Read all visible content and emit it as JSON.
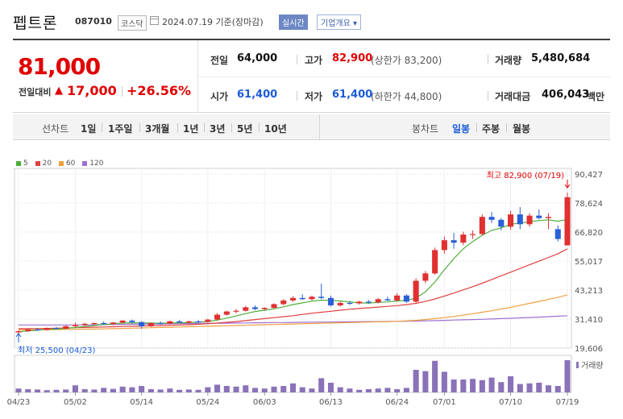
{
  "header": {
    "name": "펩트론",
    "code": "087010",
    "market": "코스닥",
    "date_text": "2024.07.19 기준(장마감)",
    "realtime": "실시간",
    "company_overview": "기업개요",
    "company_overview_arrow": "▾"
  },
  "quote": {
    "price": "81,000",
    "change_label": "전일대비",
    "change_arrow": "▲",
    "change": "17,000",
    "rate": "+26.56%",
    "prev_close_label": "전일",
    "prev_close": "64,000",
    "high_label": "고가",
    "high": "82,900",
    "upper_limit": "(상한가 83,200)",
    "volume_label": "거래량",
    "volume": "5,480,684",
    "open_label": "시가",
    "open": "61,400",
    "low_label": "저가",
    "low": "61,400",
    "lower_limit": "(하한가 44,800)",
    "amount_label": "거래대금",
    "amount": "406,043",
    "amount_unit": "백만"
  },
  "period_bar": {
    "line_label": "선차트",
    "line_items": [
      "1일",
      "1주일",
      "3개월",
      "1년",
      "3년",
      "5년",
      "10년"
    ],
    "candle_label": "봉차트",
    "candle_items": [
      "일봉",
      "주봉",
      "월봉"
    ],
    "candle_active": "일봉"
  },
  "colors": {
    "up": "#e03030",
    "down": "#2a5fd8",
    "ma5": "#4caf3a",
    "ma20": "#e04040",
    "ma60": "#f0a040",
    "ma120": "#a070d0",
    "volume": "#8a72b8"
  },
  "chart_data": {
    "type": "candlestick",
    "legend": [
      {
        "name": "5",
        "color": "#4caf3a"
      },
      {
        "name": "20",
        "color": "#e04040"
      },
      {
        "name": "60",
        "color": "#f0a040"
      },
      {
        "name": "120",
        "color": "#a070d0"
      }
    ],
    "y_ticks": [
      "90,427",
      "78,624",
      "66,820",
      "55,017",
      "43,213",
      "31,410",
      "19,606"
    ],
    "y_tick_values": [
      90427,
      78624,
      66820,
      55017,
      43213,
      31410,
      19606
    ],
    "ylim": [
      19606,
      90427
    ],
    "x_ticks": [
      "04/23",
      "05/02",
      "05/14",
      "05/24",
      "06/03",
      "06/13",
      "06/24",
      "07/01",
      "07/10",
      "07/19"
    ],
    "x_tick_index": [
      0,
      6,
      13,
      20,
      26,
      33,
      40,
      45,
      52,
      58
    ],
    "max_annotation": "최고 82,900 (07/19)",
    "min_annotation": "최저 25,500 (04/23)",
    "volume_label": "거래량",
    "candles": [
      {
        "o": 26000,
        "h": 26800,
        "l": 25500,
        "c": 26500
      },
      {
        "o": 26500,
        "h": 27500,
        "l": 26200,
        "c": 27200
      },
      {
        "o": 27200,
        "h": 27800,
        "l": 26800,
        "c": 27000
      },
      {
        "o": 27000,
        "h": 28000,
        "l": 26800,
        "c": 27800
      },
      {
        "o": 27800,
        "h": 28200,
        "l": 27200,
        "c": 27500
      },
      {
        "o": 27500,
        "h": 28800,
        "l": 27200,
        "c": 28500
      },
      {
        "o": 28500,
        "h": 30000,
        "l": 28000,
        "c": 29000
      },
      {
        "o": 29000,
        "h": 29800,
        "l": 28500,
        "c": 29500
      },
      {
        "o": 29500,
        "h": 30000,
        "l": 29000,
        "c": 29800
      },
      {
        "o": 29800,
        "h": 30500,
        "l": 29000,
        "c": 29400
      },
      {
        "o": 29400,
        "h": 30200,
        "l": 29000,
        "c": 30000
      },
      {
        "o": 30000,
        "h": 31000,
        "l": 29500,
        "c": 30800
      },
      {
        "o": 30800,
        "h": 31200,
        "l": 29800,
        "c": 30200
      },
      {
        "o": 30200,
        "h": 30500,
        "l": 27500,
        "c": 28500
      },
      {
        "o": 28500,
        "h": 30000,
        "l": 28200,
        "c": 29800
      },
      {
        "o": 29800,
        "h": 30500,
        "l": 29200,
        "c": 29500
      },
      {
        "o": 29500,
        "h": 30800,
        "l": 29300,
        "c": 30500
      },
      {
        "o": 30500,
        "h": 31000,
        "l": 29800,
        "c": 30000
      },
      {
        "o": 30000,
        "h": 30800,
        "l": 29500,
        "c": 30500
      },
      {
        "o": 30500,
        "h": 31000,
        "l": 29800,
        "c": 30300
      },
      {
        "o": 30300,
        "h": 31500,
        "l": 30000,
        "c": 31200
      },
      {
        "o": 31200,
        "h": 33800,
        "l": 30800,
        "c": 33200
      },
      {
        "o": 33200,
        "h": 34800,
        "l": 32800,
        "c": 34500
      },
      {
        "o": 34500,
        "h": 35500,
        "l": 33800,
        "c": 34800
      },
      {
        "o": 34800,
        "h": 36800,
        "l": 34500,
        "c": 36200
      },
      {
        "o": 36200,
        "h": 37000,
        "l": 35000,
        "c": 35500
      },
      {
        "o": 35500,
        "h": 36200,
        "l": 34800,
        "c": 36000
      },
      {
        "o": 36000,
        "h": 37800,
        "l": 35500,
        "c": 37500
      },
      {
        "o": 37500,
        "h": 39500,
        "l": 37000,
        "c": 39000
      },
      {
        "o": 39000,
        "h": 40800,
        "l": 38500,
        "c": 40000
      },
      {
        "o": 40000,
        "h": 41500,
        "l": 39200,
        "c": 39500
      },
      {
        "o": 39500,
        "h": 41000,
        "l": 39000,
        "c": 40500
      },
      {
        "o": 40500,
        "h": 45800,
        "l": 39500,
        "c": 40000
      },
      {
        "o": 40000,
        "h": 41000,
        "l": 36500,
        "c": 37000
      },
      {
        "o": 37000,
        "h": 38500,
        "l": 36500,
        "c": 38000
      },
      {
        "o": 38000,
        "h": 38800,
        "l": 37200,
        "c": 37800
      },
      {
        "o": 37800,
        "h": 38800,
        "l": 37300,
        "c": 38500
      },
      {
        "o": 38500,
        "h": 39200,
        "l": 37600,
        "c": 38200
      },
      {
        "o": 38200,
        "h": 40000,
        "l": 37800,
        "c": 39500
      },
      {
        "o": 39500,
        "h": 40500,
        "l": 38800,
        "c": 39000
      },
      {
        "o": 39000,
        "h": 42000,
        "l": 38500,
        "c": 41000
      },
      {
        "o": 41000,
        "h": 41500,
        "l": 38000,
        "c": 38500
      },
      {
        "o": 38500,
        "h": 48000,
        "l": 38000,
        "c": 47000
      },
      {
        "o": 47000,
        "h": 51000,
        "l": 46000,
        "c": 50000
      },
      {
        "o": 50000,
        "h": 60500,
        "l": 49500,
        "c": 59500
      },
      {
        "o": 59500,
        "h": 65000,
        "l": 58000,
        "c": 63500
      },
      {
        "o": 63500,
        "h": 66500,
        "l": 60000,
        "c": 62500
      },
      {
        "o": 62500,
        "h": 67000,
        "l": 61500,
        "c": 65800
      },
      {
        "o": 65800,
        "h": 67500,
        "l": 64000,
        "c": 66000
      },
      {
        "o": 66000,
        "h": 74000,
        "l": 65500,
        "c": 73000
      },
      {
        "o": 73000,
        "h": 75000,
        "l": 70500,
        "c": 71800
      },
      {
        "o": 71800,
        "h": 72500,
        "l": 67500,
        "c": 69000
      },
      {
        "o": 69000,
        "h": 75500,
        "l": 67800,
        "c": 74000
      },
      {
        "o": 74000,
        "h": 77000,
        "l": 68000,
        "c": 70000
      },
      {
        "o": 70000,
        "h": 74500,
        "l": 69000,
        "c": 73500
      },
      {
        "o": 73500,
        "h": 76000,
        "l": 72000,
        "c": 72500
      },
      {
        "o": 72500,
        "h": 74500,
        "l": 68000,
        "c": 73000
      },
      {
        "o": 68000,
        "h": 69500,
        "l": 63000,
        "c": 64000
      },
      {
        "o": 61400,
        "h": 82900,
        "l": 61400,
        "c": 81000
      }
    ],
    "volumes": [
      12,
      10,
      9,
      7,
      8,
      9,
      22,
      10,
      9,
      14,
      11,
      18,
      16,
      20,
      10,
      9,
      12,
      8,
      9,
      8,
      16,
      24,
      20,
      18,
      22,
      14,
      12,
      18,
      20,
      28,
      16,
      12,
      44,
      30,
      16,
      12,
      8,
      10,
      12,
      14,
      10,
      14,
      70,
      66,
      98,
      64,
      40,
      40,
      42,
      38,
      46,
      32,
      50,
      26,
      28,
      30,
      22,
      20,
      100
    ],
    "ma5": [
      26200,
      26600,
      26900,
      27200,
      27400,
      27600,
      28000,
      28400,
      28800,
      29200,
      29500,
      29800,
      29900,
      29800,
      29800,
      29700,
      29800,
      29900,
      30000,
      30200,
      30400,
      31000,
      31800,
      32700,
      33600,
      34500,
      35000,
      35600,
      36400,
      37300,
      38000,
      38700,
      39100,
      39000,
      38800,
      38400,
      38000,
      37900,
      38200,
      38400,
      38800,
      39000,
      40000,
      42500,
      46500,
      51500,
      56000,
      60000,
      63000,
      65500,
      67500,
      68500,
      70000,
      70500,
      71000,
      71500,
      71800,
      71200,
      72000
    ],
    "ma20": [
      27500,
      27500,
      27550,
      27600,
      27700,
      27800,
      27900,
      28000,
      28100,
      28200,
      28300,
      28400,
      28500,
      28600,
      28700,
      28800,
      28900,
      29000,
      29100,
      29300,
      29500,
      29800,
      30100,
      30400,
      30800,
      31200,
      31600,
      32000,
      32400,
      32800,
      33300,
      33800,
      34200,
      34600,
      35000,
      35400,
      35700,
      36000,
      36300,
      36600,
      36900,
      37300,
      37800,
      38600,
      39600,
      40800,
      42000,
      43300,
      44600,
      46000,
      47500,
      49000,
      50500,
      52000,
      53500,
      55000,
      56500,
      58000,
      60000
    ],
    "ma60": [
      27000,
      27000,
      27050,
      27100,
      27150,
      27200,
      27250,
      27300,
      27350,
      27400,
      27500,
      27600,
      27700,
      27800,
      27900,
      28000,
      28100,
      28200,
      28300,
      28400,
      28500,
      28600,
      28700,
      28800,
      28900,
      29000,
      29100,
      29200,
      29300,
      29400,
      29500,
      29600,
      29700,
      29800,
      29900,
      30000,
      30100,
      30200,
      30300,
      30400,
      30500,
      30700,
      30900,
      31200,
      31600,
      32000,
      32500,
      33000,
      33600,
      34200,
      34800,
      35500,
      36200,
      37000,
      37800,
      38600,
      39400,
      40300,
      41200
    ],
    "ma120": [
      29000,
      29000,
      29000,
      29000,
      29000,
      29000,
      29000,
      29050,
      29100,
      29150,
      29200,
      29250,
      29300,
      29350,
      29400,
      29450,
      29500,
      29550,
      29600,
      29650,
      29700,
      29700,
      29750,
      29800,
      29850,
      29900,
      29950,
      30000,
      30000,
      30050,
      30100,
      30150,
      30200,
      30200,
      30250,
      30300,
      30350,
      30400,
      30400,
      30450,
      30500,
      30550,
      30600,
      30700,
      30800,
      30900,
      31000,
      31100,
      31200,
      31300,
      31450,
      31600,
      31750,
      31900,
      32050,
      32200,
      32400,
      32600,
      32800
    ]
  }
}
